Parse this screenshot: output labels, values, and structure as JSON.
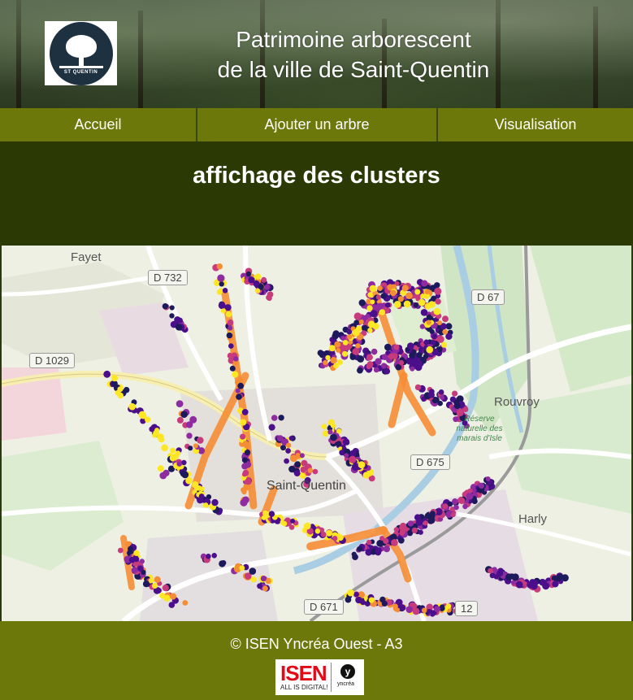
{
  "header": {
    "title_line1": "Patrimoine arborescent",
    "title_line2": "de la ville de Saint-Quentin",
    "logo_text": "ST QUENTIN"
  },
  "nav": {
    "items": [
      {
        "label": "Accueil"
      },
      {
        "label": "Ajouter un arbre"
      },
      {
        "label": "Visualisation"
      }
    ]
  },
  "main": {
    "heading": "affichage des clusters"
  },
  "map": {
    "place_labels": {
      "fayet": "Fayet",
      "rouvroy": "Rouvroy",
      "harly": "Harly",
      "saint_quentin": "Saint-Quentin",
      "reserve": "Réserve naturelle des marais d'Isle"
    },
    "road_labels": {
      "d732": "D 732",
      "d67": "D 67",
      "d1029": "D 1029",
      "d675": "D 675",
      "d671": "D 671",
      "d12": "12"
    },
    "cluster_colors": [
      "#f58d34",
      "#fde725",
      "#4b0f8c",
      "#8f2ba0",
      "#c73b7c",
      "#1d1a5c"
    ]
  },
  "footer": {
    "copyright": "© ISEN Yncréa Ouest - A3",
    "isen_word": "ISEN",
    "isen_tagline": "ALL IS DIGITAL!",
    "yncrea_letter": "y",
    "yncrea_word": "yncréa"
  }
}
